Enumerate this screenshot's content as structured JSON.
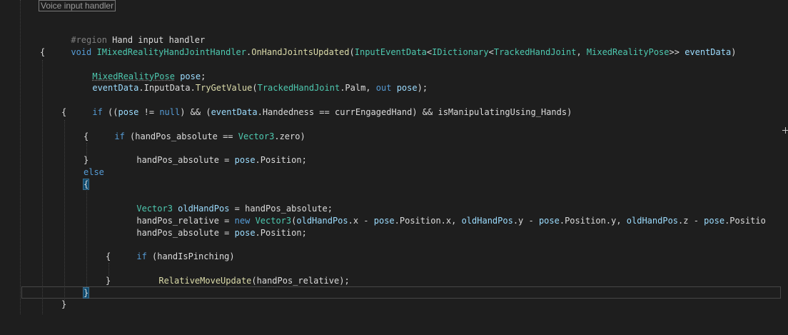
{
  "collapsed_region": "Voice input handler",
  "lines": {
    "l02_a": "#region",
    "l02_b": " Hand input handler",
    "l03_a": "void ",
    "l03_b": "IMixedRealityHandJointHandler",
    "l03_c": ".",
    "l03_d": "OnHandJointsUpdated",
    "l03_e": "(",
    "l03_f": "InputEventData",
    "l03_g": "<",
    "l03_h": "IDictionary",
    "l03_i": "<",
    "l03_j": "TrackedHandJoint",
    "l03_k": ", ",
    "l03_l": "MixedRealityPose",
    "l03_m": ">> ",
    "l03_n": "eventData",
    "l03_o": ")",
    "l04": "{",
    "l05_a": "MixedRealityPose",
    "l05_b": " ",
    "l05_c": "pose",
    "l05_d": ";",
    "l06_a": "eventData",
    "l06_b": ".InputData.",
    "l06_c": "TryGetValue",
    "l06_d": "(",
    "l06_e": "TrackedHandJoint",
    "l06_f": ".Palm, ",
    "l06_g": "out",
    "l06_h": " ",
    "l06_i": "pose",
    "l06_j": ");",
    "l08_a": "if",
    "l08_b": " ((",
    "l08_c": "pose",
    "l08_d": " != ",
    "l08_e": "null",
    "l08_f": ") && (",
    "l08_g": "eventData",
    "l08_h": ".Handedness == currEngagedHand) && isManipulatingUsing_Hands)",
    "l09": "{",
    "l10_a": "if",
    "l10_b": " (handPos_absolute == ",
    "l10_c": "Vector3",
    "l10_d": ".zero)",
    "l11": "{",
    "l12_a": "handPos_absolute = ",
    "l12_b": "pose",
    "l12_c": ".Position;",
    "l13": "}",
    "l14": "else",
    "l15": "{",
    "l16_a": "Vector3",
    "l16_b": " ",
    "l16_c": "oldHandPos",
    "l16_d": " = handPos_absolute;",
    "l17_a": "handPos_relative = ",
    "l17_b": "new",
    "l17_c": " ",
    "l17_d": "Vector3",
    "l17_e": "(",
    "l17_f": "oldHandPos",
    "l17_g": ".x - ",
    "l17_h": "pose",
    "l17_i": ".Position.x, ",
    "l17_j": "oldHandPos",
    "l17_k": ".y - ",
    "l17_l": "pose",
    "l17_m": ".Position.y, ",
    "l17_n": "oldHandPos",
    "l17_o": ".z - ",
    "l17_p": "pose",
    "l17_q": ".Positio",
    "l18_a": "handPos_absolute = ",
    "l18_b": "pose",
    "l18_c": ".Position;",
    "l20_a": "if",
    "l20_b": " (handIsPinching)",
    "l21": "{",
    "l22_a": "RelativeMoveUpdate",
    "l22_b": "(handPos_relative);",
    "l23": "}",
    "l24": "}",
    "l25": "}"
  },
  "colors": {
    "background": "#1e1e1e",
    "keyword": "#569cd6",
    "type": "#4ec9b0",
    "method": "#dcdcaa",
    "variable": "#9cdcfe",
    "text": "#dcdcdc"
  }
}
